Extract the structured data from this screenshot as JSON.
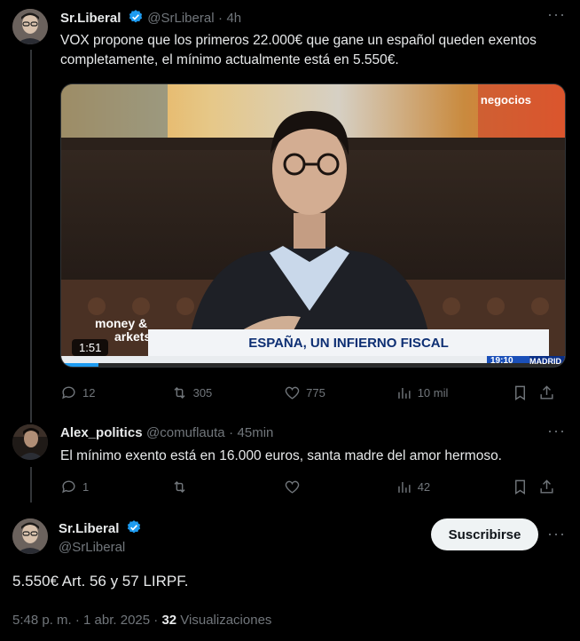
{
  "tweet1": {
    "name": "Sr.Liberal",
    "handle": "@SrLiberal",
    "sep": "·",
    "time": "4h",
    "text": "VOX propone que los primeros 22.000€ que gane un español queden exentos completamente, el mínimo actualmente está en 5.550€.",
    "video": {
      "duration": "1:51",
      "logo_top": "negocios",
      "brand_line1": "money &",
      "brand_line2": "arkets.",
      "headline": "ESPAÑA, UN INFIERNO FISCAL",
      "clock": "19:10",
      "city": "MADRID"
    },
    "stats": {
      "replies": "12",
      "retweets": "305",
      "likes": "775",
      "views": "10 mil"
    }
  },
  "tweet2": {
    "name": "Alex_politics",
    "handle": "@comuflauta",
    "sep": "·",
    "time": "45min",
    "text": "El mínimo exento está en 16.000 euros, santa madre del amor hermoso.",
    "stats": {
      "replies": "1",
      "retweets": "",
      "likes": "",
      "views": "42"
    }
  },
  "tweet3": {
    "name": "Sr.Liberal",
    "handle": "@SrLiberal",
    "subscribe_label": "Suscribirse",
    "text": "5.550€ Art. 56 y 57 LIRPF.",
    "timestamp": "5:48 p. m. · 1 abr. 2025 ·",
    "views_count": "32",
    "views_label": "Visualizaciones"
  },
  "colors": {
    "accent": "#1d9bf0",
    "muted": "#71767b",
    "text": "#e7e9ea",
    "bg": "#000000"
  }
}
